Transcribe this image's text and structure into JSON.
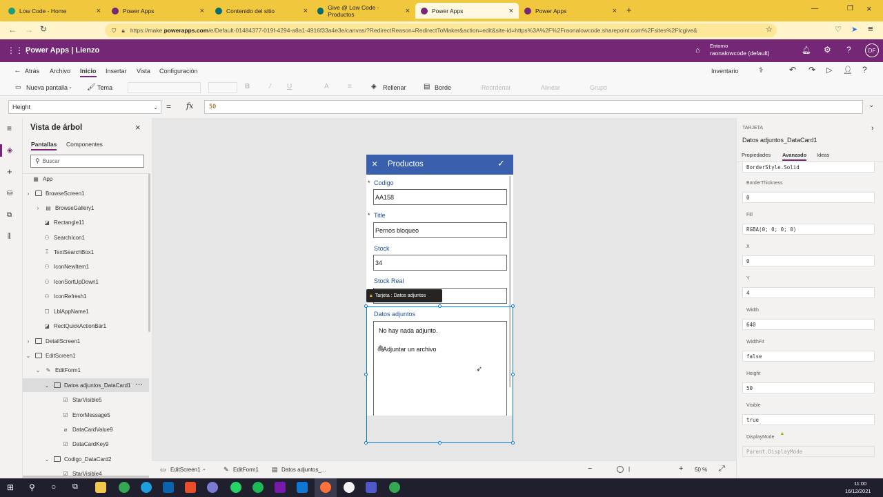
{
  "browser": {
    "tabs": [
      {
        "label": "Low Code - Home",
        "color": "#1b9f7a"
      },
      {
        "label": "Power Apps",
        "color": "#742774"
      },
      {
        "label": "Contenido del sitio",
        "color": "#036c70"
      },
      {
        "label": "Give @ Low Code - Productos",
        "color": "#036c70"
      },
      {
        "label": "Power Apps",
        "color": "#742774"
      },
      {
        "label": "Power Apps",
        "color": "#742774"
      }
    ],
    "url_prefix": "https://make.",
    "url_domain": "powerapps.com",
    "url_rest": "/e/Default-01484377-019f-4294-a8a1-4916f33a4e3e/canvas/?RedirectReason=RedirectToMaker&action=edit&site-id=https%3A%2F%2Fraonalowcode.sharepoint.com%2Fsites%2Flcgive&"
  },
  "header": {
    "title": "Power Apps  |  Lienzo",
    "env_label": "Entorno",
    "env_value": "raonalowcode (default)",
    "avatar": "DF",
    "color": "#742774"
  },
  "menu": {
    "back": "Atrás",
    "items": [
      "Archivo",
      "Inicio",
      "Insertar",
      "Vista",
      "Configuración"
    ],
    "inventory": "Inventario"
  },
  "toolbar": {
    "new_screen": "Nueva pantalla",
    "theme": "Tema",
    "fill": "Rellenar",
    "border": "Borde",
    "reorder": "Reordenar",
    "align": "Alinear",
    "group": "Grupo"
  },
  "formula": {
    "property": "Height",
    "fx": "fx",
    "value": "50"
  },
  "tree": {
    "title": "Vista de árbol",
    "tab_screens": "Pantallas",
    "tab_components": "Componentes",
    "search_placeholder": "Buscar",
    "nodes": [
      "App",
      "BrowseScreen1",
      "BrowseGallery1",
      "Rectangle11",
      "SearchIcon1",
      "TextSearchBox1",
      "IconNewItem1",
      "IconSortUpDown1",
      "IconRefresh1",
      "LblAppName1",
      "RectQuickActionBar1",
      "DetailScreen1",
      "EditScreen1",
      "EditForm1",
      "Datos adjuntos_DataCard1",
      "StarVisible5",
      "ErrorMessage5",
      "DataCardValue9",
      "DataCardKey9",
      "Codigo_DataCard2",
      "StarVisible4"
    ]
  },
  "form": {
    "header_title": "Productos",
    "header_color": "#3a5fad",
    "fields": [
      {
        "label": "Codigo",
        "value": "AA158",
        "required": "*"
      },
      {
        "label": "Title",
        "value": "Pernos bloqueo",
        "required": "*"
      },
      {
        "label": "Stock",
        "value": "34",
        "required": ""
      },
      {
        "label": "Stock Real",
        "value": "",
        "required": ""
      }
    ],
    "tooltip": "Tarjeta : Datos adjuntos",
    "attach_label": "Datos adjuntos",
    "attach_empty": "No hay nada adjunto.",
    "attach_link": "Adjuntar un archivo"
  },
  "bottom": {
    "crumb1": "EditScreen1",
    "crumb2": "EditForm1",
    "crumb3": "Datos adjuntos_...",
    "zoom": "50  %"
  },
  "rpanel": {
    "type": "TARJETA",
    "name": "Datos adjuntos_DataCard1",
    "tabs": [
      "Propiedades",
      "Avanzado",
      "Ideas"
    ],
    "top_value": "BorderStyle.Solid",
    "props": [
      {
        "label": "BorderThickness",
        "value": "0"
      },
      {
        "label": "Fill",
        "value": "RGBA(0; 0; 0; 0)"
      },
      {
        "label": "X",
        "value": "0"
      },
      {
        "label": "Y",
        "value": "4"
      },
      {
        "label": "Width",
        "value": "640"
      },
      {
        "label": "WidthFit",
        "value": "false"
      },
      {
        "label": "Height",
        "value": "50"
      },
      {
        "label": "Visible",
        "value": "true"
      },
      {
        "label": "DisplayMode",
        "value": "Parent.DisplayMode"
      }
    ]
  },
  "taskbar": {
    "time": "11:00",
    "date": "16/12/2021"
  }
}
